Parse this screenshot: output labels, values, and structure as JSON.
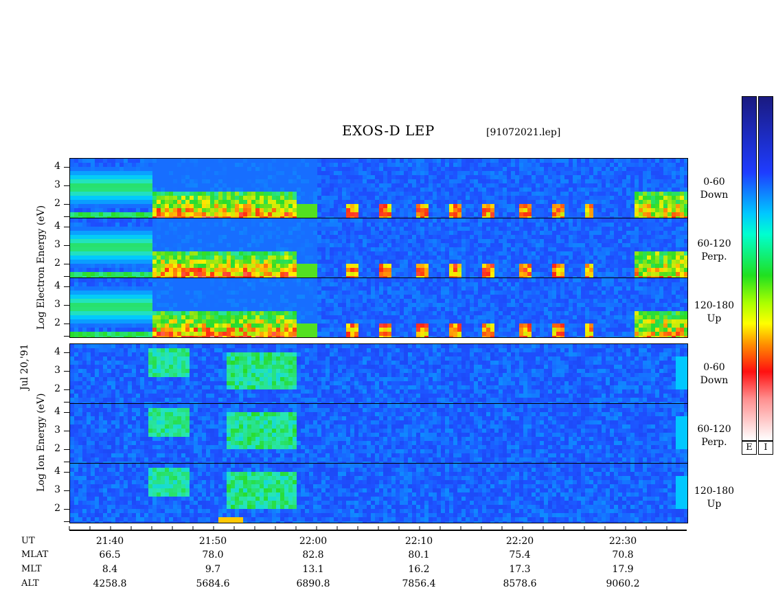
{
  "header": {
    "title": "EXOS-D LEP",
    "file": "[91072021.lep]"
  },
  "side_label_date": "Jul 20,'91",
  "groups": [
    {
      "name": "electron",
      "ylabel": "Log  Electron  Energy (eV)",
      "panels": [
        {
          "angle_line1": "0-60",
          "angle_line2": "Down"
        },
        {
          "angle_line1": "60-120",
          "angle_line2": "Perp."
        },
        {
          "angle_line1": "120-180",
          "angle_line2": "Up"
        }
      ]
    },
    {
      "name": "ion",
      "ylabel": "Log  Ion  Energy (eV)",
      "panels": [
        {
          "angle_line1": "0-60",
          "angle_line2": "Down"
        },
        {
          "angle_line1": "60-120",
          "angle_line2": "Perp."
        },
        {
          "angle_line1": "120-180",
          "angle_line2": "Up"
        }
      ]
    }
  ],
  "y_ticks": [
    "4",
    "3",
    "2"
  ],
  "x_axis": {
    "row_labels": [
      "UT",
      "MLAT",
      "MLT",
      "ALT"
    ],
    "columns": [
      {
        "UT": "21:40",
        "MLAT": "66.5",
        "MLT": "8.4",
        "ALT": "4258.8"
      },
      {
        "UT": "21:50",
        "MLAT": "78.0",
        "MLT": "9.7",
        "ALT": "5684.6"
      },
      {
        "UT": "22:00",
        "MLAT": "82.8",
        "MLT": "13.1",
        "ALT": "6890.8"
      },
      {
        "UT": "22:10",
        "MLAT": "80.1",
        "MLT": "16.2",
        "ALT": "7856.4"
      },
      {
        "UT": "22:20",
        "MLAT": "75.4",
        "MLT": "17.3",
        "ALT": "8578.6"
      },
      {
        "UT": "22:30",
        "MLAT": "70.8",
        "MLT": "17.9",
        "ALT": "9060.2"
      }
    ]
  },
  "colorbars": [
    {
      "label": "E"
    },
    {
      "label": "I"
    }
  ],
  "chart_data": {
    "type": "heatmap",
    "title": "EXOS-D LEP",
    "subtitle": "[91072021.lep]",
    "x_ticks": [
      "21:40",
      "21:50",
      "22:00",
      "22:10",
      "22:20",
      "22:30"
    ],
    "y_ticks": [
      2,
      3,
      4
    ],
    "ylim": [
      1,
      4
    ],
    "panels": [
      "Electron 0-60 Down",
      "Electron 60-120 Perp.",
      "Electron 120-180 Up",
      "Ion 0-60 Down",
      "Ion 60-120 Perp.",
      "Ion 120-180 Up"
    ],
    "colors": {
      "background": "#1a2fd0",
      "low": "#1e40e0",
      "mid": "#2ee8d0",
      "high": "#ff2020"
    }
  }
}
